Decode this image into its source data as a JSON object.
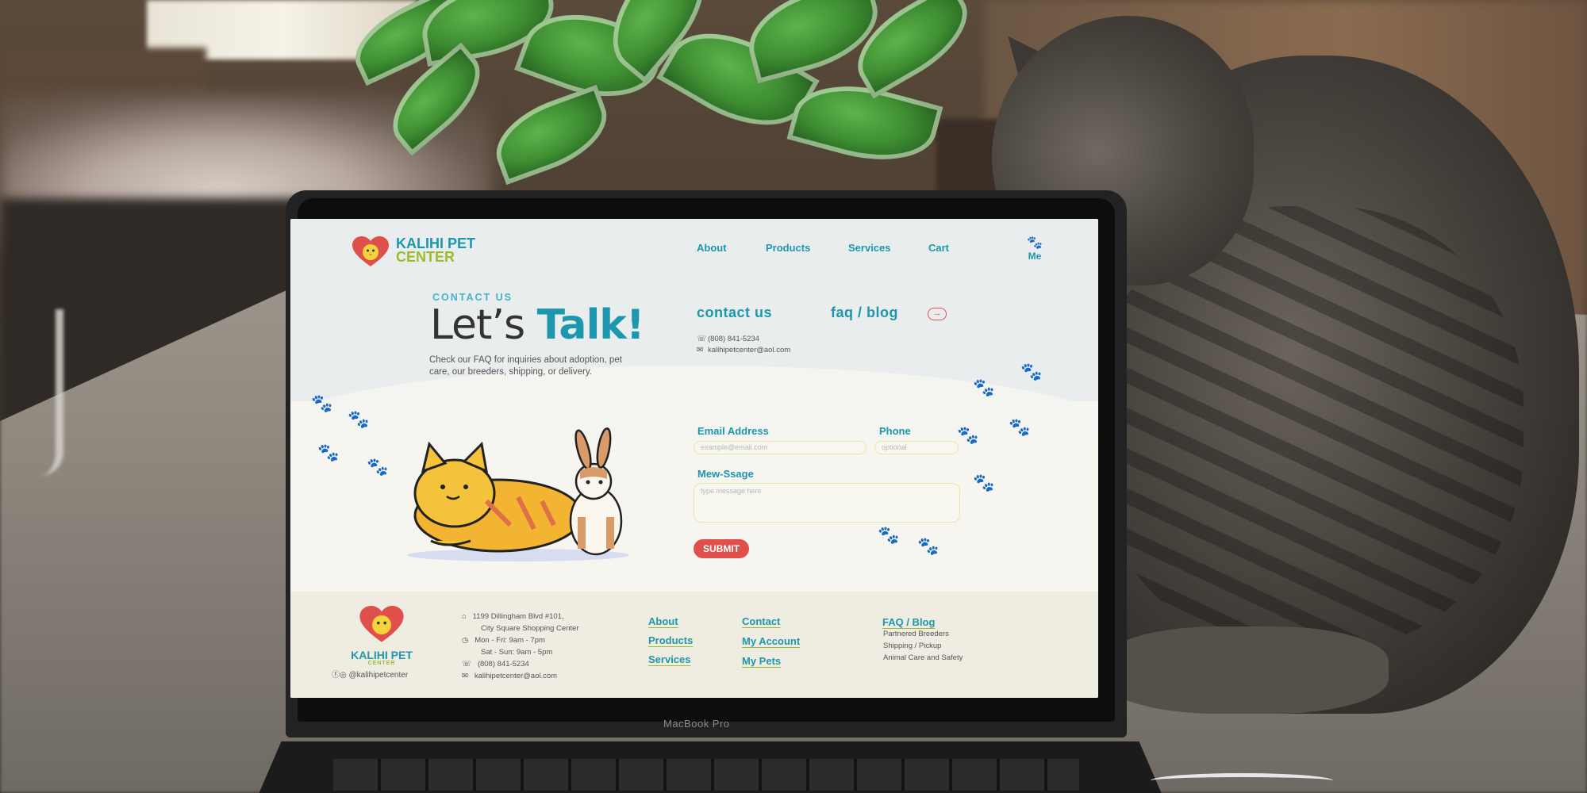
{
  "site": {
    "logo": {
      "line1": "KALIHI PET",
      "line2": "CENTER"
    },
    "nav": [
      {
        "label": "About"
      },
      {
        "label": "Products"
      },
      {
        "label": "Services"
      },
      {
        "label": "Cart"
      }
    ],
    "menu_label": "Me",
    "hero": {
      "eyebrow": "CONTACT US",
      "headline_plain": "Let’s",
      "headline_bold": "Talk!",
      "description": "Check our FAQ for inquiries about adoption, pet care, our breeders, shipping, or delivery."
    },
    "tabs": {
      "contact": "contact us",
      "faq": "faq / blog",
      "arrow": "→"
    },
    "contact": {
      "phone": "(808) 841-5234",
      "email": "kalihipetcenter@aol.com"
    },
    "form": {
      "email_label": "Email Address",
      "email_placeholder": "example@email.com",
      "phone_label": "Phone",
      "phone_placeholder": "optional",
      "message_label": "Mew-Ssage",
      "message_placeholder": "type message here",
      "submit": "SUBMIT"
    },
    "footer": {
      "logo_line1": "KALIHI PET",
      "logo_line2": "CENTER",
      "social": "@kalihipetcenter",
      "address1": "1199 Dillingham Blvd #101,",
      "address2": "City Square Shopping Center",
      "hours1": "Mon - Fri: 9am - 7pm",
      "hours2": "Sat - Sun: 9am - 5pm",
      "phone": "(808) 841-5234",
      "email": "kalihipetcenter@aol.com",
      "col1": [
        "About",
        "Products",
        "Services"
      ],
      "col2": [
        "Contact",
        "My Account",
        "My Pets"
      ],
      "faq_title": "FAQ / Blog",
      "faq_items": [
        "Partnered Breeders",
        "Shipping / Pickup",
        "Animal Care and Safety"
      ]
    }
  },
  "device": {
    "brand": "MacBook Pro"
  },
  "colors": {
    "teal": "#1c97ad",
    "green": "#9bbd2c",
    "coral": "#e0504a"
  }
}
